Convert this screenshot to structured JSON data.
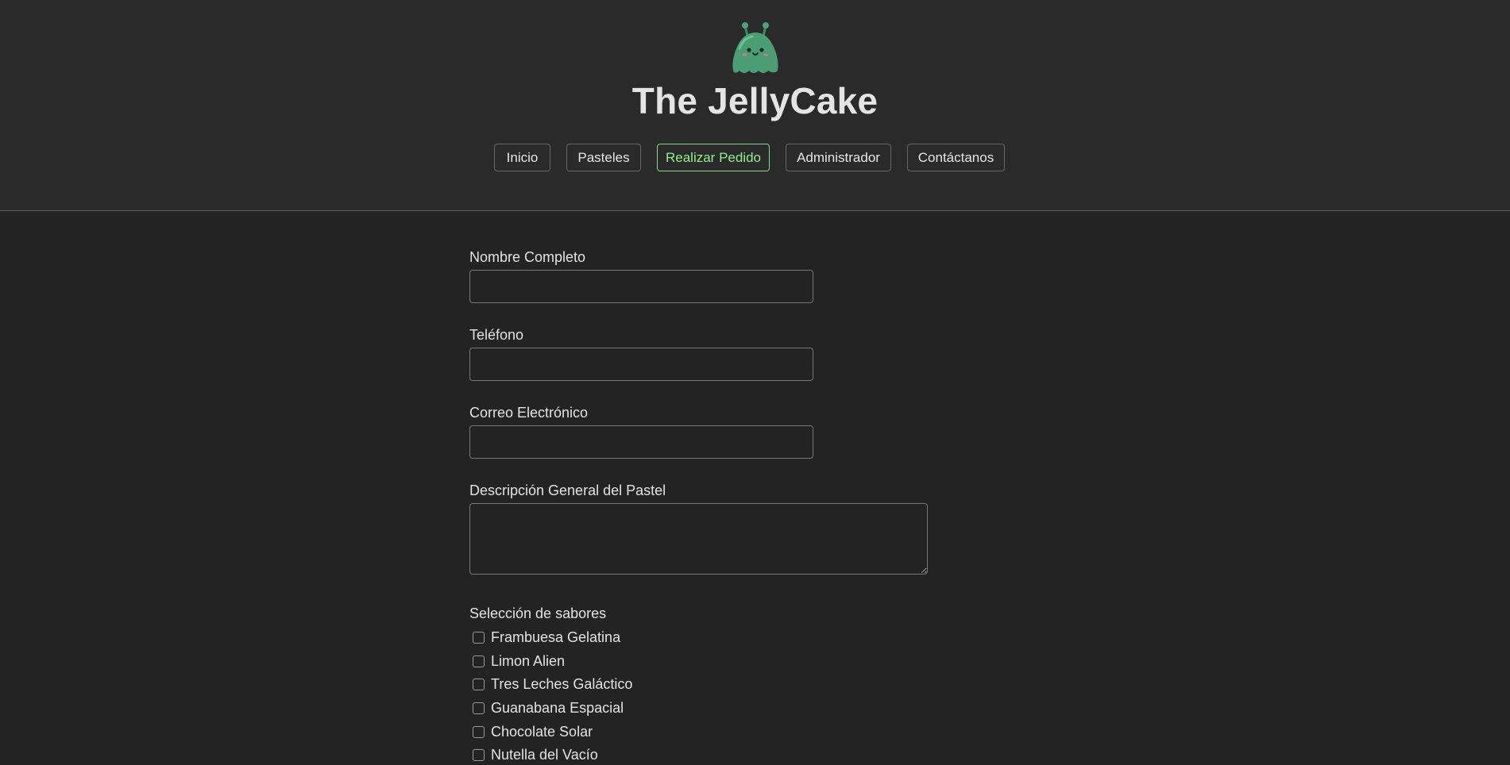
{
  "header": {
    "logo_icon": "jelly-alien-icon",
    "title": "The JellyCake",
    "accent_color": "#7ee07a"
  },
  "nav": {
    "items": [
      {
        "label": "Inicio",
        "active": false
      },
      {
        "label": "Pasteles",
        "active": false
      },
      {
        "label": "Realizar Pedido",
        "active": true
      },
      {
        "label": "Administrador",
        "active": false
      },
      {
        "label": "Contáctanos",
        "active": false
      }
    ]
  },
  "form": {
    "name_label": "Nombre Completo",
    "name_value": "",
    "phone_label": "Teléfono",
    "phone_value": "",
    "email_label": "Correo Electrónico",
    "email_value": "",
    "description_label": "Descripción General del Pastel",
    "description_value": "",
    "flavors_label": "Selección de sabores",
    "flavors": [
      {
        "label": "Frambuesa Gelatina",
        "checked": false
      },
      {
        "label": "Limon Alien",
        "checked": false
      },
      {
        "label": "Tres Leches Galáctico",
        "checked": false
      },
      {
        "label": "Guanabana Espacial",
        "checked": false
      },
      {
        "label": "Chocolate Solar",
        "checked": false
      },
      {
        "label": "Nutella del Vacío",
        "checked": false
      }
    ]
  }
}
